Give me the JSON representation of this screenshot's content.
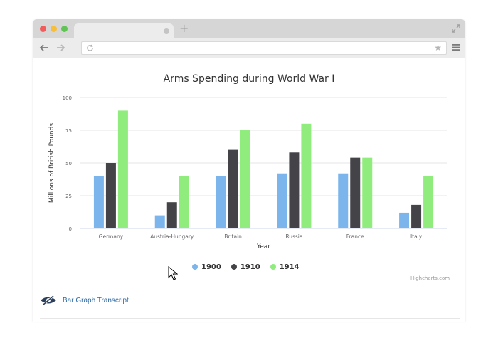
{
  "browser": {
    "new_tab_glyph": "+",
    "star_glyph": "★",
    "icons": [
      "close-dot",
      "minimize-dot",
      "maximize-dot",
      "expand-icon",
      "back-arrow-icon",
      "forward-arrow-icon",
      "reload-icon",
      "star-icon",
      "hamburger-menu-icon"
    ]
  },
  "chart_data": {
    "type": "bar",
    "title": "Arms Spending during World War I",
    "xlabel": "Year",
    "ylabel": "Millions of British Pounds",
    "categories": [
      "Germany",
      "Austria-Hungary",
      "Britain",
      "Russia",
      "France",
      "Italy"
    ],
    "series": [
      {
        "name": "1900",
        "color": "#7cb5ec",
        "values": [
          40,
          10,
          40,
          42,
          42,
          12
        ]
      },
      {
        "name": "1910",
        "color": "#434348",
        "values": [
          50,
          20,
          60,
          58,
          54,
          18
        ]
      },
      {
        "name": "1914",
        "color": "#90ed7d",
        "values": [
          90,
          40,
          75,
          80,
          54,
          40
        ]
      }
    ],
    "ylim": [
      0,
      100
    ],
    "yticks": [
      "0",
      "25",
      "50",
      "75",
      "100"
    ],
    "grid": true,
    "legend_position": "bottom-center"
  },
  "credits": "Highcharts.com",
  "transcript": {
    "label": "Bar Graph Transcript",
    "icon": "eye-slash-icon"
  }
}
